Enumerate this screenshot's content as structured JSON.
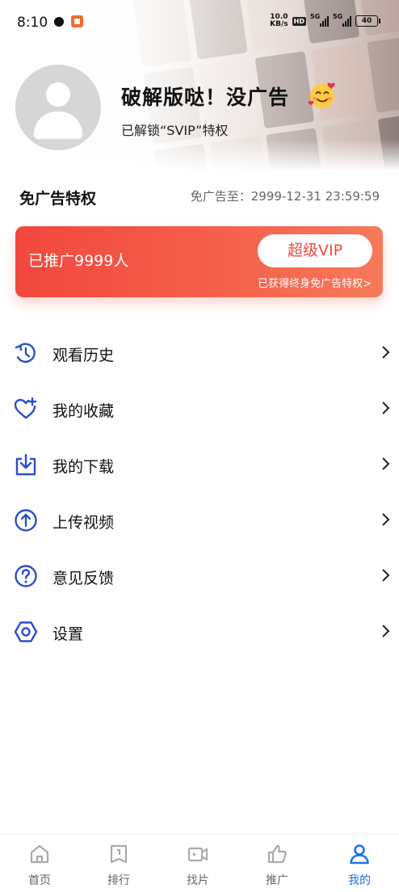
{
  "status_bar": {
    "time": "8:10",
    "net_speed_top": "10.0",
    "net_speed_unit": "KB/s",
    "hd_label": "HD",
    "signal_1": "5G",
    "signal_2": "5G",
    "battery": "40"
  },
  "profile": {
    "name": "破解版哒！没广告",
    "subtitle": "已解锁“SVIP”特权"
  },
  "adfree": {
    "title": "免广告特权",
    "until": "免广告至：2999-12-31 23:59:59"
  },
  "vip_card": {
    "promoted": "已推广9999人",
    "button": "超级VIP",
    "note": "已获得终身免广告特权>"
  },
  "menu": [
    {
      "label": "观看历史",
      "icon": "history-icon"
    },
    {
      "label": "我的收藏",
      "icon": "favorite-icon"
    },
    {
      "label": "我的下载",
      "icon": "download-icon"
    },
    {
      "label": "上传视频",
      "icon": "upload-icon"
    },
    {
      "label": "意见反馈",
      "icon": "help-icon"
    },
    {
      "label": "设置",
      "icon": "settings-icon"
    }
  ],
  "bottom_nav": [
    {
      "label": "首页",
      "icon": "home-icon",
      "active": false
    },
    {
      "label": "排行",
      "icon": "ranking-icon",
      "active": false
    },
    {
      "label": "找片",
      "icon": "video-camera-icon",
      "active": false
    },
    {
      "label": "推广",
      "icon": "thumbs-up-icon",
      "active": false
    },
    {
      "label": "我的",
      "icon": "profile-icon",
      "active": true
    }
  ],
  "colors": {
    "accent_blue": "#1f72e8",
    "icon_blue": "#2b4fc9",
    "vip_red": "#f2473e"
  }
}
